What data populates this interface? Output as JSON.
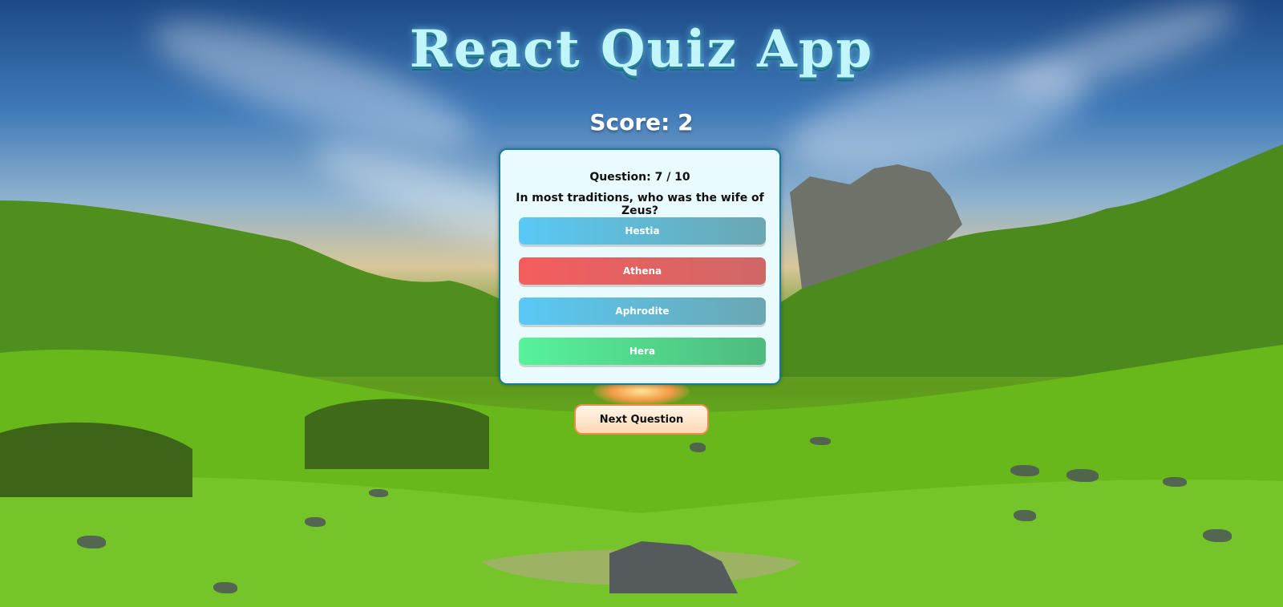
{
  "header": {
    "title": "React Quiz App"
  },
  "score": {
    "text": "Score: 2"
  },
  "question": {
    "number_text": "Question: 7 / 10",
    "text": "In most traditions, who was the wife of Zeus?"
  },
  "answers": [
    {
      "label": "Hestia",
      "state": "neutral"
    },
    {
      "label": "Athena",
      "state": "wrong"
    },
    {
      "label": "Aphrodite",
      "state": "neutral"
    },
    {
      "label": "Hera",
      "state": "correct"
    }
  ],
  "controls": {
    "next_label": "Next Question"
  },
  "colors": {
    "title": "#bff5fb",
    "card_border": "#137d98",
    "neutral": "#58c9f5",
    "wrong": "#f55d5d",
    "correct": "#57f29b",
    "next_border": "#e88f4d"
  }
}
